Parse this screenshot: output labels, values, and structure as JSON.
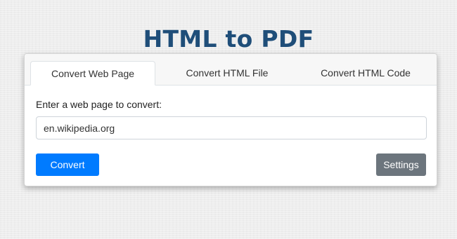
{
  "page": {
    "title": "HTML to PDF"
  },
  "tabs": [
    {
      "label": "Convert Web Page",
      "active": true
    },
    {
      "label": "Convert HTML File",
      "active": false
    },
    {
      "label": "Convert HTML Code",
      "active": false
    }
  ],
  "form": {
    "label": "Enter a web page to convert:",
    "url_value": "en.wikipedia.org"
  },
  "actions": {
    "convert_label": "Convert",
    "settings_label": "Settings"
  },
  "colors": {
    "title": "#1f4e79",
    "primary": "#007bff",
    "secondary": "#6c757d"
  }
}
